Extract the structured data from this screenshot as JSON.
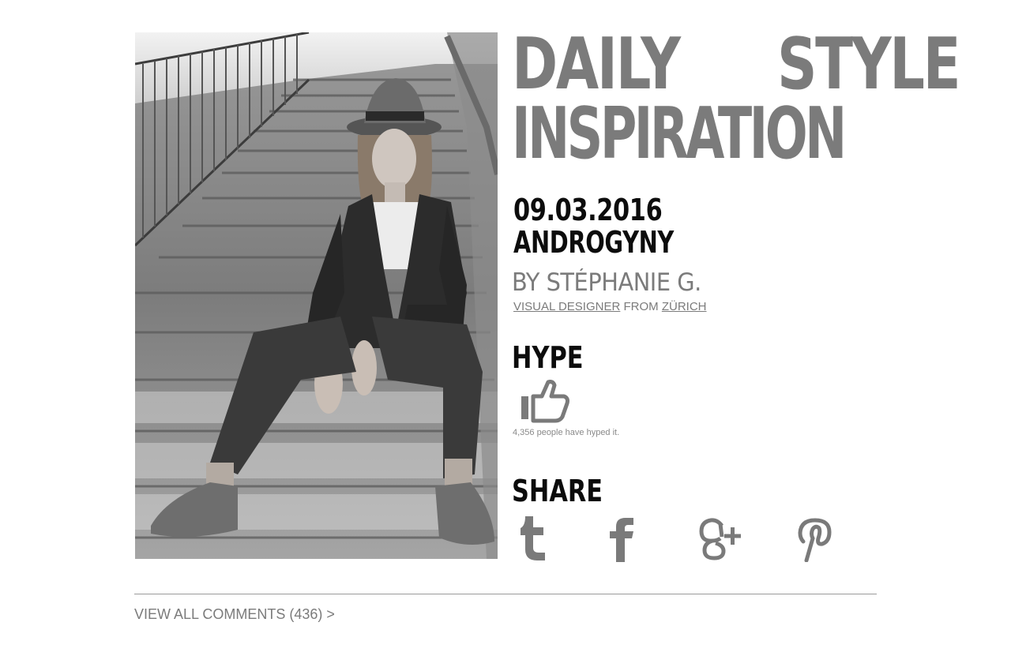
{
  "headline": {
    "line1_word1": "DAILY",
    "line1_word2": "STYLE",
    "line2": "INSPIRATION"
  },
  "post": {
    "date": "09.03.2016",
    "topic": "ANDROGYNY"
  },
  "author": {
    "byline": "BY STÉPHANIE G.",
    "role_link": "VISUAL DESIGNER",
    "from_text": " FROM ",
    "location_link": "ZÜRICH"
  },
  "hype": {
    "title": "HYPE",
    "count_text": "4,356 people have hyped it.",
    "icon": "thumbs-up-icon"
  },
  "share": {
    "title": "SHARE",
    "icons": [
      "tumblr-icon",
      "facebook-icon",
      "google-plus-icon",
      "pinterest-icon"
    ]
  },
  "comments": {
    "link_text": "VIEW ALL COMMENTS (436) >"
  },
  "colors": {
    "headline_grey": "#7b7b7b",
    "heading_black": "#0c0c0c",
    "icon_grey": "#7a7a7a",
    "divider": "#9a9a9a"
  }
}
